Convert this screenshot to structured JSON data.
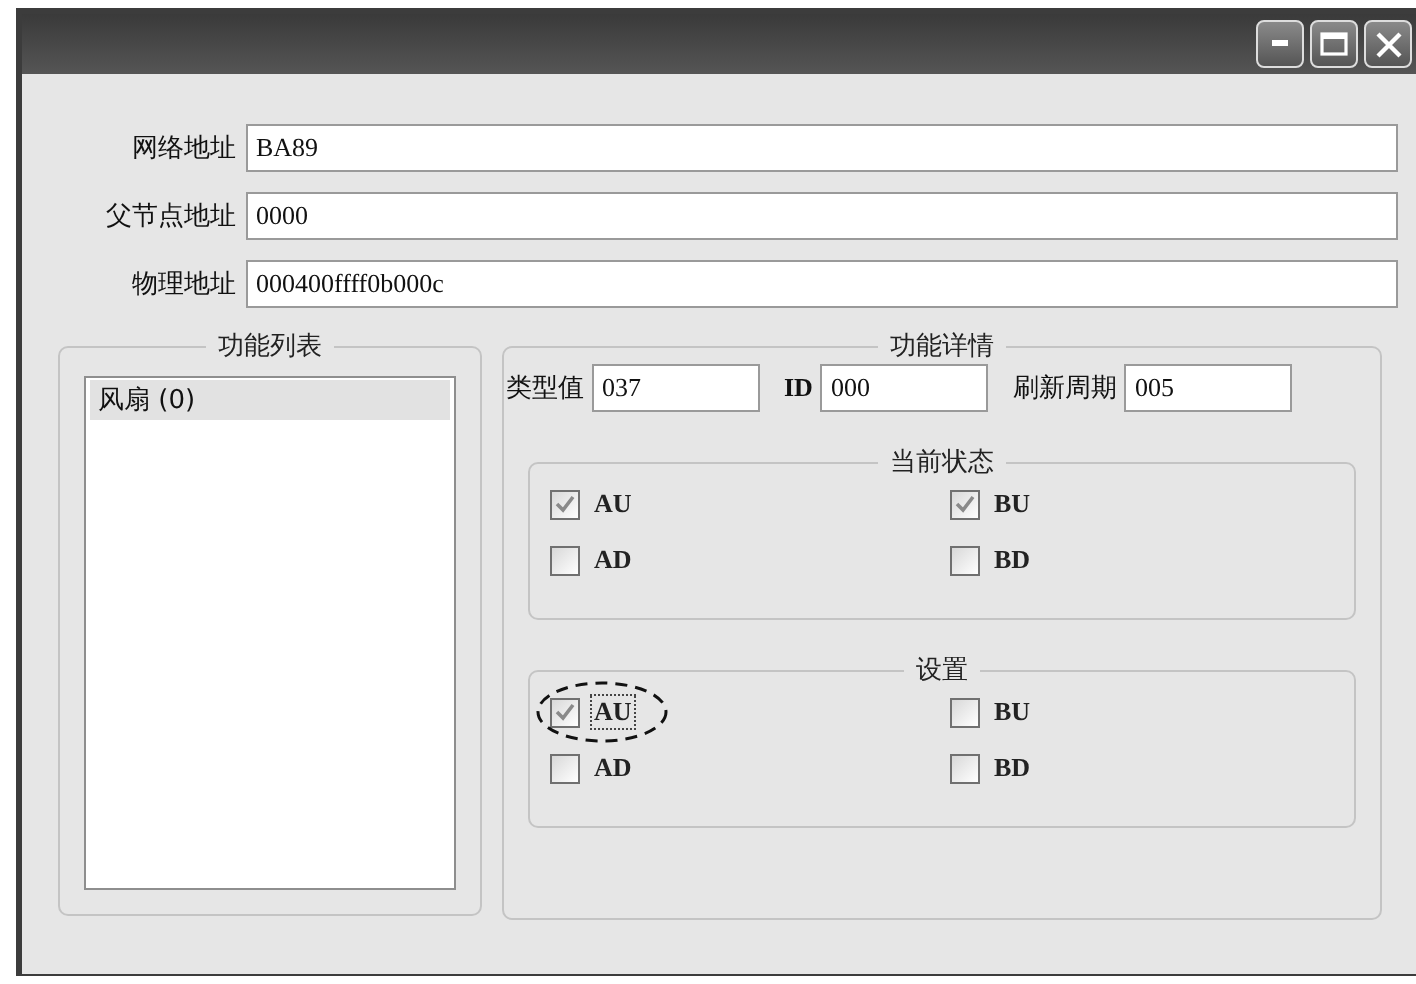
{
  "window": {
    "buttons": [
      {
        "kind": "minimize"
      },
      {
        "kind": "maximize"
      },
      {
        "kind": "close"
      }
    ]
  },
  "fields": [
    {
      "label": "网络地址",
      "value": "BA89"
    },
    {
      "label": "父节点地址",
      "value": "0000"
    },
    {
      "label": "物理地址",
      "value": "000400ffff0b000c"
    }
  ],
  "function_list": {
    "title": "功能列表",
    "items": [
      {
        "label": "风扇 (0)",
        "selected": true
      }
    ]
  },
  "function_details": {
    "title": "功能详情",
    "fields": [
      {
        "label": "类型值",
        "value": "037"
      },
      {
        "label": "ID",
        "value": "000"
      },
      {
        "label": "刷新周期",
        "value": "005"
      }
    ],
    "groups": [
      {
        "title": "当前状态",
        "checkboxes": [
          {
            "label": "AU",
            "checked": true,
            "focused": false,
            "circled": false
          },
          {
            "label": "BU",
            "checked": true,
            "focused": false,
            "circled": false
          },
          {
            "label": "AD",
            "checked": false,
            "focused": false,
            "circled": false
          },
          {
            "label": "BD",
            "checked": false,
            "focused": false,
            "circled": false
          }
        ]
      },
      {
        "title": "设置",
        "checkboxes": [
          {
            "label": "AU",
            "checked": true,
            "focused": true,
            "circled": true
          },
          {
            "label": "BU",
            "checked": false,
            "focused": false,
            "circled": false
          },
          {
            "label": "AD",
            "checked": false,
            "focused": false,
            "circled": false
          },
          {
            "label": "BD",
            "checked": false,
            "focused": false,
            "circled": false
          }
        ]
      }
    ]
  }
}
